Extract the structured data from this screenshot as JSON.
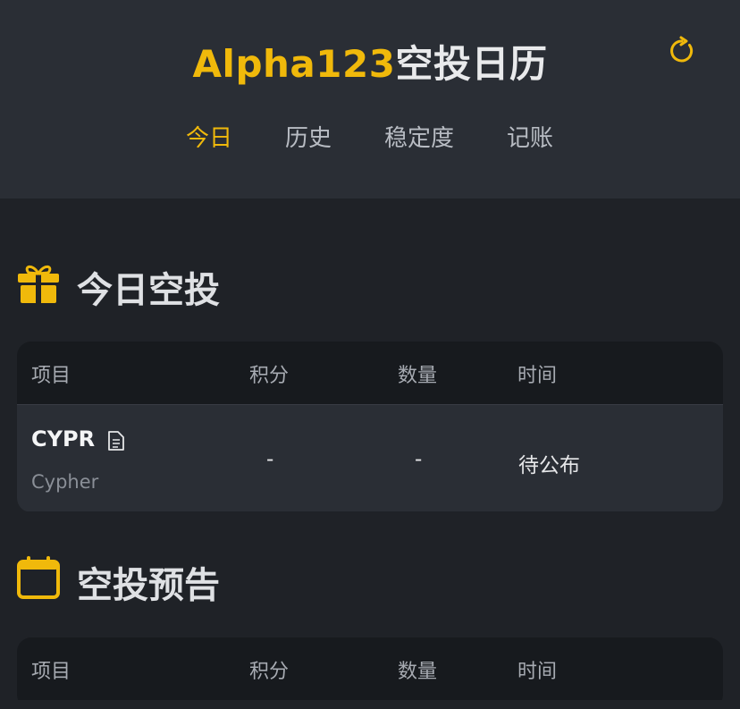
{
  "header": {
    "title_brand": "Alpha123",
    "title_rest": "空投日历",
    "refresh_icon": "refresh-icon",
    "accent_color": "#f0b90b"
  },
  "nav": {
    "tabs": [
      {
        "label": "今日",
        "active": true
      },
      {
        "label": "历史",
        "active": false
      },
      {
        "label": "稳定度",
        "active": false
      },
      {
        "label": "记账",
        "active": false
      }
    ]
  },
  "today": {
    "title": "今日空投",
    "icon": "gift-icon",
    "columns": [
      "项目",
      "积分",
      "数量",
      "时间"
    ],
    "rows": [
      {
        "symbol": "CYPR",
        "name": "Cypher",
        "points": "-",
        "amount": "-",
        "time": "待公布",
        "icon": "document-icon"
      }
    ]
  },
  "upcoming": {
    "title": "空投预告",
    "icon": "calendar-icon",
    "columns": [
      "项目",
      "积分",
      "数量",
      "时间"
    ]
  }
}
